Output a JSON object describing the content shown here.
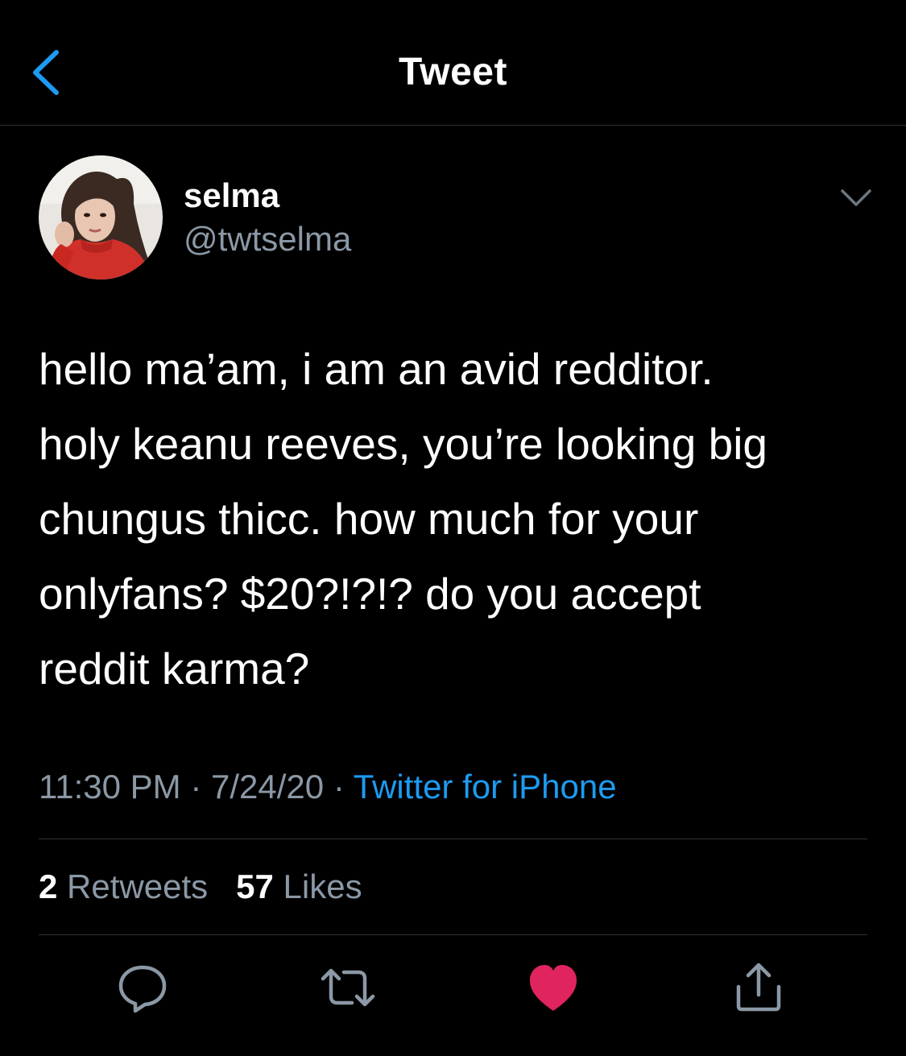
{
  "header": {
    "title": "Tweet",
    "back_icon": "chevron-left-icon",
    "accent_color": "#1d9bf0"
  },
  "author": {
    "display_name": "selma",
    "handle": "@twtselma",
    "avatar_icon": "avatar-photo"
  },
  "tweet": {
    "text": "hello ma’am, i am an avid redditor.\nholy keanu reeves, you’re looking big\nchungus thicc. how much for your\nonlyfans? $20?!?!? do you accept\nreddit karma?",
    "time": "11:30 PM",
    "date": "7/24/20",
    "separator": "·",
    "source": "Twitter for iPhone"
  },
  "stats": {
    "retweets_count": "2",
    "retweets_label": "Retweets",
    "likes_count": "57",
    "likes_label": "Likes"
  },
  "actions": [
    {
      "name": "reply",
      "icon": "reply-icon"
    },
    {
      "name": "retweet",
      "icon": "retweet-icon"
    },
    {
      "name": "like",
      "icon": "heart-icon",
      "active": true,
      "color": "#e0245e"
    },
    {
      "name": "share",
      "icon": "share-icon"
    }
  ]
}
